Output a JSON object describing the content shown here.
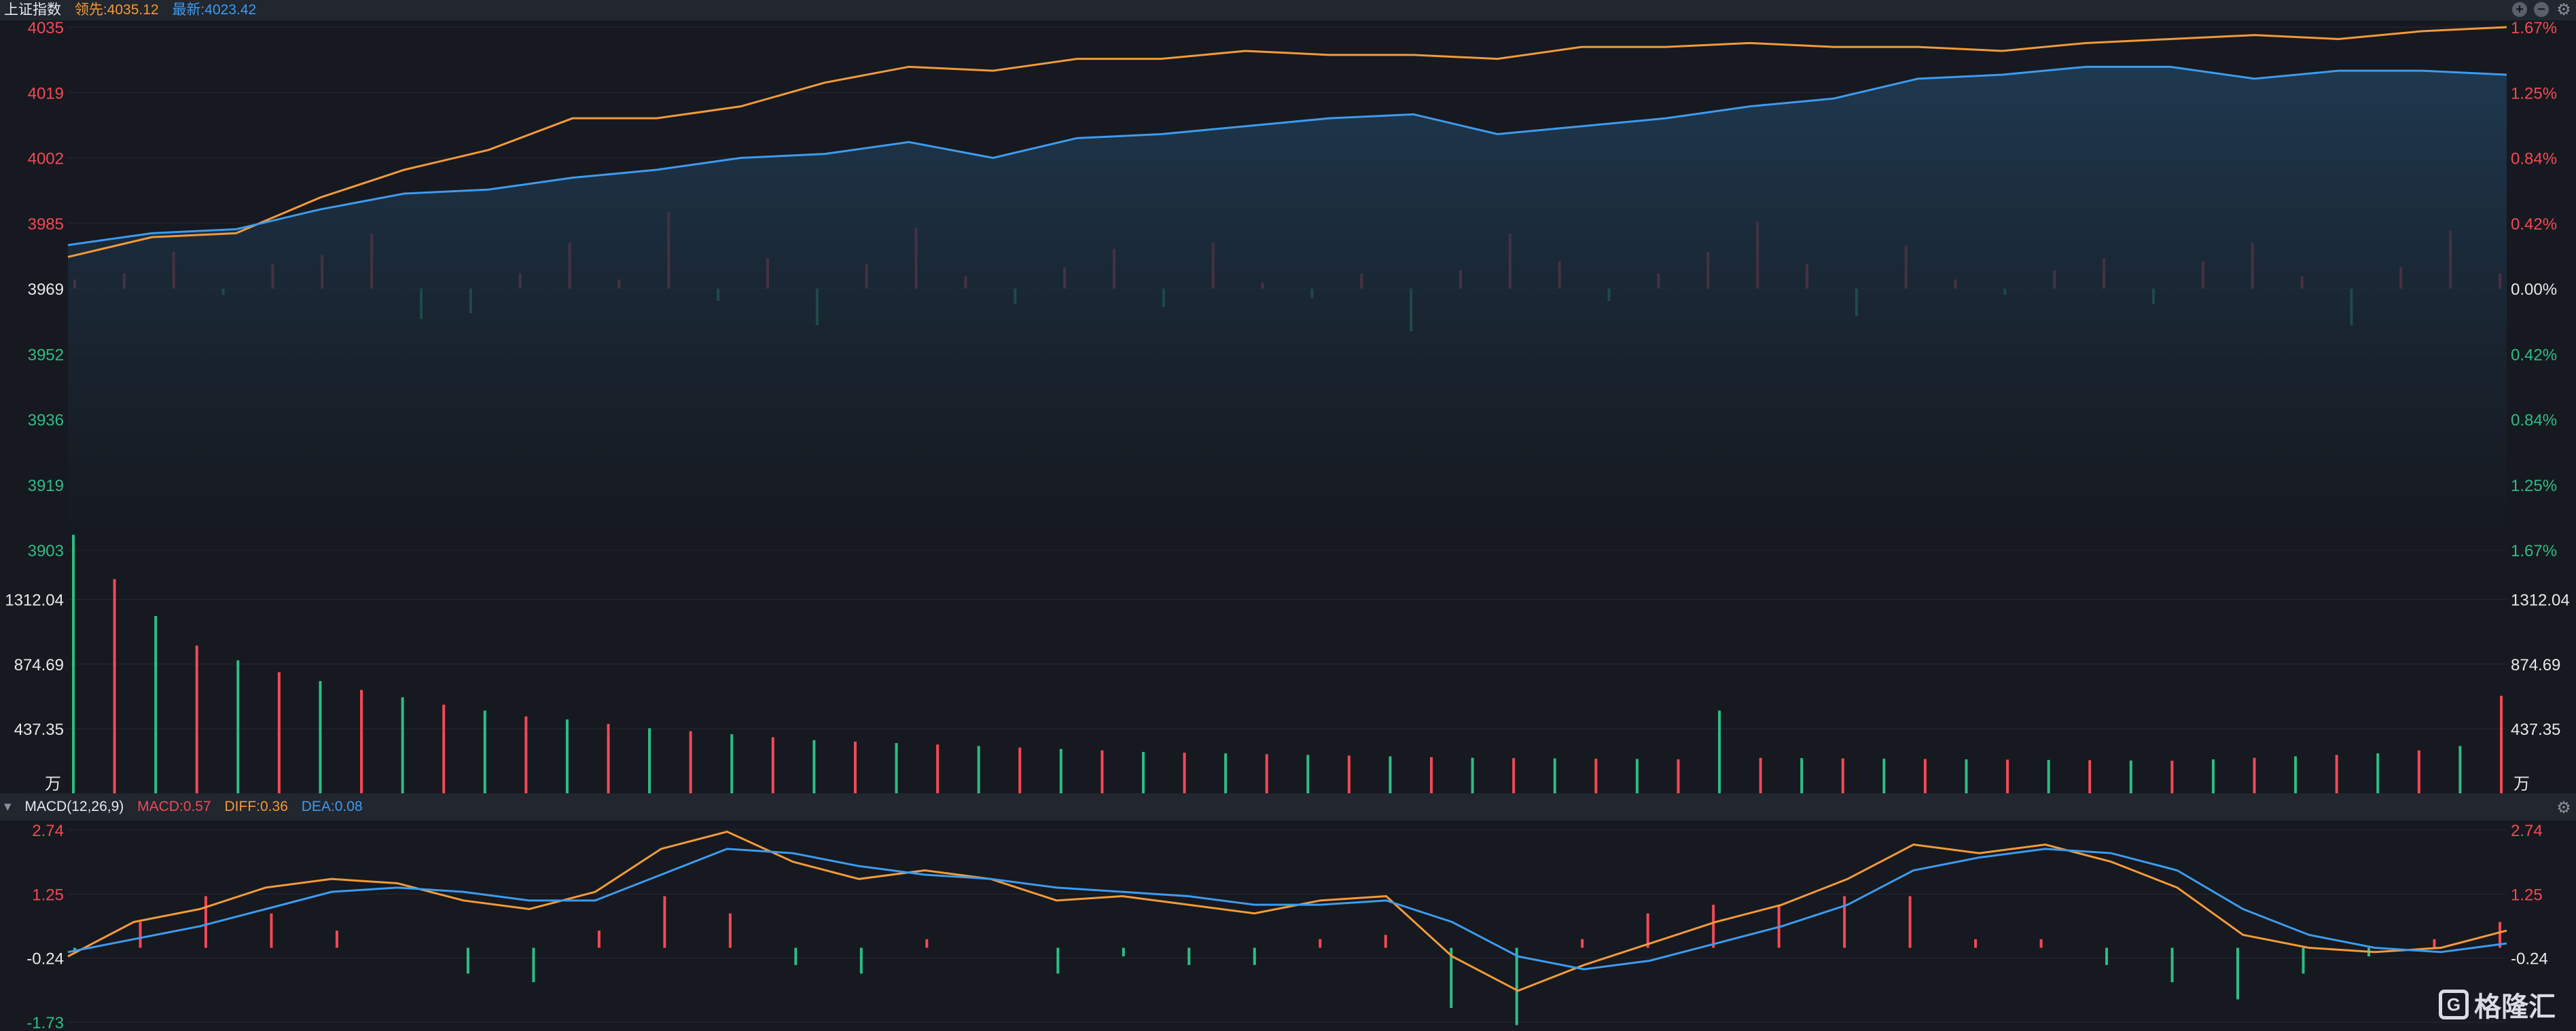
{
  "header": {
    "index_name": "上证指数",
    "lead_label": "领先:4035.12",
    "latest_label": "最新:4023.42"
  },
  "macd_header": {
    "name": "MACD(12,26,9)",
    "macd": "MACD:0.57",
    "diff": "DIFF:0.36",
    "dea": "DEA:0.08"
  },
  "logo": {
    "text": "格隆汇"
  },
  "colors": {
    "up": "#f24957",
    "down": "#2ebd85",
    "latest": "#3d9bf0",
    "lead": "#f39a3a",
    "bg": "#16191f"
  },
  "chart_data": [
    {
      "type": "line",
      "name": "price",
      "y_ticks_left": [
        "4035",
        "4019",
        "4002",
        "3985",
        "3969",
        "3952",
        "3936",
        "3919",
        "3903"
      ],
      "y_ticks_right": [
        "1.67%",
        "1.25%",
        "0.84%",
        "0.42%",
        "0.00%",
        "0.42%",
        "0.84%",
        "1.25%",
        "1.67%"
      ],
      "ylim": [
        3903,
        4035
      ],
      "prev_close": 3969,
      "series": [
        {
          "key": "lead",
          "values": [
            3977,
            3982,
            3983,
            3992,
            3999,
            4004,
            4012,
            4012,
            4015,
            4021,
            4025,
            4024,
            4027,
            4027,
            4029,
            4028,
            4028,
            4027,
            4030,
            4030,
            4031,
            4030,
            4030,
            4029,
            4031,
            4032,
            4033,
            4032,
            4034,
            4035
          ]
        },
        {
          "key": "latest",
          "values": [
            3980,
            3983,
            3984,
            3989,
            3993,
            3994,
            3997,
            3999,
            4002,
            4003,
            4006,
            4002,
            4007,
            4008,
            4010,
            4012,
            4013,
            4008,
            4010,
            4012,
            4015,
            4017,
            4022,
            4023,
            4025,
            4025,
            4022,
            4024,
            4024,
            4023
          ]
        }
      ],
      "breadth_bars": [
        0.3,
        0.5,
        1.2,
        -0.2,
        0.8,
        1.1,
        1.8,
        -1.0,
        -0.8,
        0.5,
        1.5,
        0.3,
        2.5,
        -0.4,
        1.0,
        -1.2,
        0.8,
        2.0,
        0.4,
        -0.5,
        0.7,
        1.3,
        -0.6,
        1.5,
        0.2,
        -0.3,
        0.5,
        -1.4,
        0.6,
        1.8,
        0.9,
        -0.4,
        0.5,
        1.2,
        2.2,
        0.8,
        -0.9,
        1.4,
        0.3,
        -0.2,
        0.6,
        1.0,
        -0.5,
        0.9,
        1.5,
        0.4,
        -1.2,
        0.7,
        1.9,
        0.5
      ]
    },
    {
      "type": "bar",
      "name": "volume",
      "unit": "万",
      "y_ticks": [
        "1312.04",
        "874.69",
        "437.35"
      ],
      "ylim": [
        0,
        1600
      ],
      "values": [
        1750,
        1450,
        1200,
        1000,
        900,
        820,
        760,
        700,
        650,
        600,
        560,
        520,
        500,
        470,
        440,
        420,
        400,
        380,
        360,
        350,
        340,
        330,
        320,
        310,
        300,
        290,
        280,
        275,
        270,
        265,
        260,
        255,
        250,
        245,
        240,
        238,
        236,
        234,
        232,
        230,
        560,
        240,
        238,
        236,
        234,
        232,
        230,
        228,
        226,
        224,
        222,
        220,
        230,
        240,
        250,
        260,
        270,
        290,
        320,
        660
      ]
    },
    {
      "type": "line",
      "name": "macd",
      "y_ticks_left": [
        "2.74",
        "1.25",
        "-0.24",
        "-1.73"
      ],
      "y_ticks_right": [
        "2.74",
        "1.25",
        "-0.24"
      ],
      "ylim": [
        -1.73,
        2.74
      ],
      "series": [
        {
          "key": "diff",
          "values": [
            -0.2,
            0.6,
            0.9,
            1.4,
            1.6,
            1.5,
            1.1,
            0.9,
            1.3,
            2.3,
            2.7,
            2.0,
            1.6,
            1.8,
            1.6,
            1.1,
            1.2,
            1.0,
            0.8,
            1.1,
            1.2,
            -0.2,
            -1.0,
            -0.4,
            0.1,
            0.6,
            1.0,
            1.6,
            2.4,
            2.2,
            2.4,
            2.0,
            1.4,
            0.3,
            0.0,
            -0.1,
            0.0,
            0.4
          ]
        },
        {
          "key": "dea",
          "values": [
            -0.1,
            0.2,
            0.5,
            0.9,
            1.3,
            1.4,
            1.3,
            1.1,
            1.1,
            1.7,
            2.3,
            2.2,
            1.9,
            1.7,
            1.6,
            1.4,
            1.3,
            1.2,
            1.0,
            1.0,
            1.1,
            0.6,
            -0.2,
            -0.5,
            -0.3,
            0.1,
            0.5,
            1.0,
            1.8,
            2.1,
            2.3,
            2.2,
            1.8,
            0.9,
            0.3,
            0.0,
            -0.1,
            0.1
          ]
        }
      ],
      "hist": [
        -0.1,
        0.6,
        1.2,
        0.8,
        0.4,
        0.0,
        -0.6,
        -0.8,
        0.4,
        1.2,
        0.8,
        -0.4,
        -0.6,
        0.2,
        0.0,
        -0.6,
        -0.2,
        -0.4,
        -0.4,
        0.2,
        0.3,
        -1.4,
        -1.8,
        0.2,
        0.8,
        1.0,
        1.0,
        1.2,
        1.2,
        0.2,
        0.2,
        -0.4,
        -0.8,
        -1.2,
        -0.6,
        -0.2,
        0.2,
        0.6
      ]
    }
  ]
}
